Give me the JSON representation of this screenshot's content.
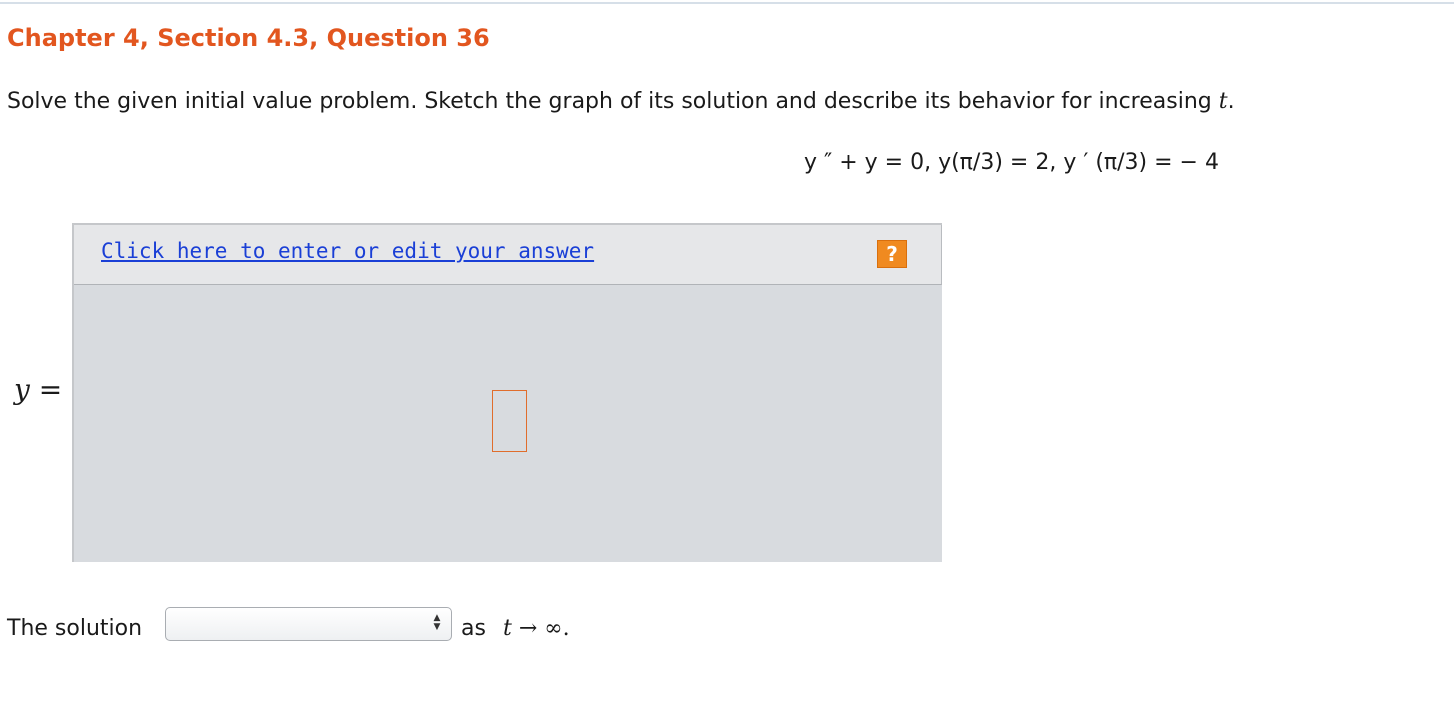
{
  "header": {
    "title": "Chapter 4, Section 4.3, Question 36"
  },
  "problem": {
    "instruction_text": "Solve the given initial value problem. Sketch the graph of its solution and describe its behavior for increasing ",
    "instruction_variable": "t",
    "instruction_end": ".",
    "equation": "y ″ + y = 0,  y(π/3) = 2,  y ′ (π/3)  = − 4"
  },
  "answer": {
    "y_label_var": "y",
    "y_label_eq": " =",
    "edit_link": "Click here to enter or edit your answer",
    "help_icon": "?"
  },
  "solution_row": {
    "label": "The solution",
    "select_value": "",
    "as_text": "as",
    "limit_var": "t",
    "limit_rest": " → ∞."
  },
  "colors": {
    "title": "#e2561f",
    "link": "#1a3fd6",
    "help_button": "#f08a20",
    "panel_bg": "#d8dbdf",
    "answer_box_border": "#e06d2c"
  }
}
